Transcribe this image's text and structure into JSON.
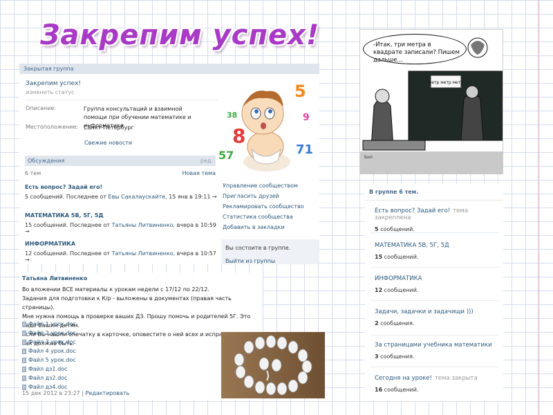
{
  "slide_title": "Закрепим успех!",
  "group": {
    "type_label": "Закрытая группа",
    "name": "Закрепим успех!",
    "status_link": "изменить статус",
    "description_label": "Описание:",
    "description": "Группа консультаций и взаимной помощи при обучении математике и информатике",
    "location_label": "Местоположение:",
    "location": "Санкт-Петербург",
    "news_link": "Свежие новости",
    "discussions_label": "Обсуждения",
    "discussions_edit": "ред.",
    "topic_count": "6 тем",
    "new_topic": "Новая тема",
    "discussions": [
      {
        "title": "Есть вопрос? Задай его!",
        "meta": "5 сообщений.  Последнее от ",
        "author": "Евы Сакалаускайте,",
        "time": " 15 янв в 19:11  →"
      },
      {
        "title": "МАТЕМАТИКА 5В, 5Г, 5Д",
        "meta": "15 сообщений.  Последнее от ",
        "author": "Татьяны Литвиненко,",
        "time": " вчера в 10:59  →"
      },
      {
        "title": "ИНФОРМАТИКА",
        "meta": "12 сообщений.  Последнее от ",
        "author": "Татьяны Литвиненко,",
        "time": " вчера в 10:57  →"
      }
    ],
    "actions": [
      "Управление сообществом",
      "Пригласить друзей",
      "Рекламировать сообщество",
      "Статистика сообщества",
      "Добавить в закладки"
    ],
    "member_text": "Вы состоите в группе.",
    "leave_link": "Выйти из группы"
  },
  "post": {
    "author": "Татьяна Литвиненко",
    "lines": [
      "Во вложении ВСЕ материалы к урокам недели с 17/12 по 22/12.",
      "Задания для подготовки к К/р - выложены в документах (правая часть страницы).",
      "Мне нужна помощь в проверке ваших ДЗ. Прошу помочь и родителей 5Г. Это надо Вашим детям.",
      "Если Вы нашли опечатку в карточке, оповестите о ней всех и исправьте на то, как должно быть."
    ],
    "files": [
      "Файл 1 урок.doc",
      "Файл 2 урок.doc",
      "Файл 3 урок.doc",
      "Файл 4 урок.doc",
      "Файл 5 урок.doc",
      "Файл дз1.doc",
      "Файл дз2.doc",
      "Файл дз4.doc"
    ],
    "date": "15 дек 2012 в 23:27",
    "separator": " | ",
    "edit_link": "Редактировать"
  },
  "cartoon": {
    "speech": "-Итак, три метра в квадрате записали? Пишем дальше...",
    "board_text": "метр метр метр",
    "signature": "Бил"
  },
  "baby_numbers": [
    "5",
    "8",
    "57",
    "71",
    "38",
    "9"
  ],
  "topics": {
    "header": "В группе 6 тем.",
    "items": [
      {
        "title": "Есть вопрос? Задай его!",
        "tag": "тема закреплена",
        "count": "5",
        "suffix": " сообщений."
      },
      {
        "title": "МАТЕМАТИКА 5В, 5Г, 5Д",
        "tag": "",
        "count": "15",
        "suffix": " сообщений."
      },
      {
        "title": "ИНФОРМАТИКА",
        "tag": "",
        "count": "12",
        "suffix": " сообщений."
      },
      {
        "title": "Задачи, задачки и задачищи )))",
        "tag": "",
        "count": "2",
        "suffix": " сообщения."
      },
      {
        "title": "За страницами учебника математики",
        "tag": "",
        "count": "3",
        "suffix": " сообщения."
      },
      {
        "title": "Сегодня на уроке!",
        "tag": "тема закрыта",
        "count": "16",
        "suffix": " сообщений."
      }
    ]
  },
  "colors": {
    "link": "#2b587a",
    "header_bg": "#dfe5ec",
    "title": "#a83ac6"
  }
}
